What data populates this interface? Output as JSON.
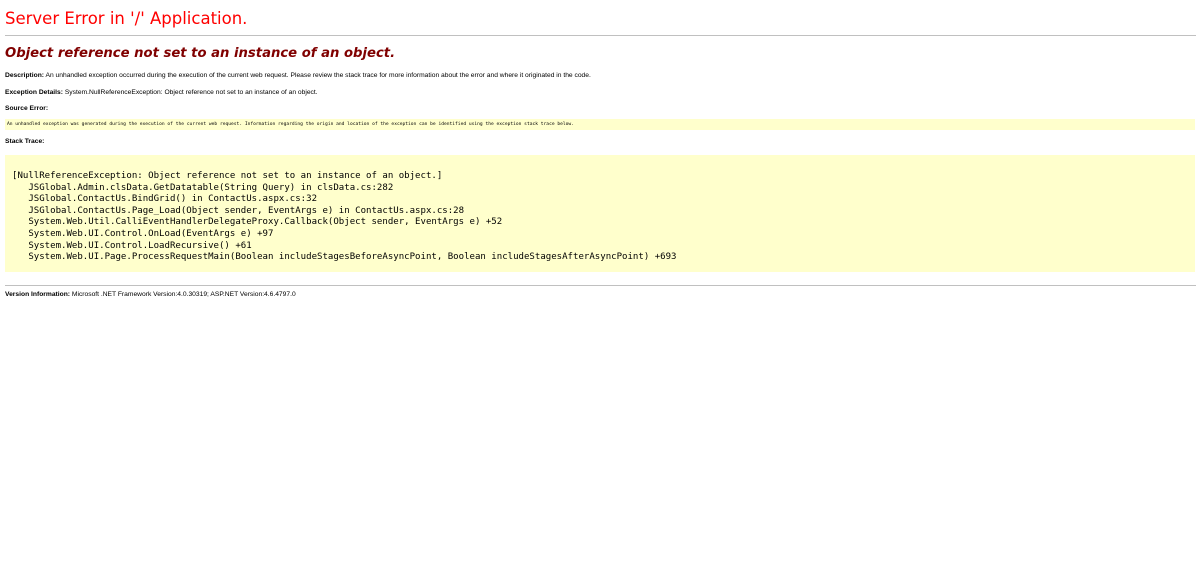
{
  "title": "Server Error in '/' Application.",
  "error_message": "Object reference not set to an instance of an object.",
  "description": {
    "label": "Description:",
    "text": " An unhandled exception occurred during the execution of the current web request. Please review the stack trace for more information about the error and where it originated in the code."
  },
  "exception_details": {
    "label": "Exception Details:",
    "text": " System.NullReferenceException: Object reference not set to an instance of an object."
  },
  "source_error": {
    "label": "Source Error:",
    "text": "An unhandled exception was generated during the execution of the current web request. Information regarding the origin and location of the exception can be identified using the exception stack trace below."
  },
  "stack_trace": {
    "label": "Stack Trace:",
    "lines": [
      "[NullReferenceException: Object reference not set to an instance of an object.]",
      "   JSGlobal.Admin.clsData.GetDatatable(String Query) in clsData.cs:282",
      "   JSGlobal.ContactUs.BindGrid() in ContactUs.aspx.cs:32",
      "   JSGlobal.ContactUs.Page_Load(Object sender, EventArgs e) in ContactUs.aspx.cs:28",
      "   System.Web.Util.CalliEventHandlerDelegateProxy.Callback(Object sender, EventArgs e) +52",
      "   System.Web.UI.Control.OnLoad(EventArgs e) +97",
      "   System.Web.UI.Control.LoadRecursive() +61",
      "   System.Web.UI.Page.ProcessRequestMain(Boolean includeStagesBeforeAsyncPoint, Boolean includeStagesAfterAsyncPoint) +693"
    ]
  },
  "version_info": {
    "label": "Version Information:",
    "text": " Microsoft .NET Framework Version:4.0.30319; ASP.NET Version:4.6.4797.0"
  },
  "colors": {
    "title": "#ff0000",
    "error_message": "#800000",
    "code_background": "#ffffcc",
    "rule": "#c0c0c0"
  }
}
